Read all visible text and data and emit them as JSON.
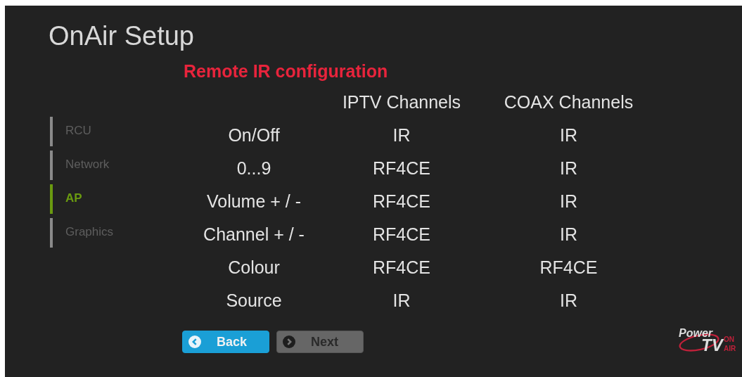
{
  "window": {
    "title": "OnAir Setup"
  },
  "sidebar": {
    "items": [
      {
        "label": "RCU",
        "selected": false
      },
      {
        "label": "Network",
        "selected": false
      },
      {
        "label": "AP",
        "selected": true
      },
      {
        "label": "Graphics",
        "selected": false
      }
    ]
  },
  "section_title": "Remote IR configuration",
  "table": {
    "columns": [
      "IPTV Channels",
      "COAX Channels"
    ],
    "rows": [
      {
        "label": "On/Off",
        "cells": [
          "IR",
          "IR"
        ]
      },
      {
        "label": "0...9",
        "cells": [
          "RF4CE",
          "IR"
        ]
      },
      {
        "label": "Volume + / -",
        "cells": [
          "RF4CE",
          "IR"
        ]
      },
      {
        "label": "Channel + / -",
        "cells": [
          "RF4CE",
          "IR"
        ]
      },
      {
        "label": "Colour",
        "cells": [
          "RF4CE",
          "RF4CE"
        ]
      },
      {
        "label": "Source",
        "cells": [
          "IR",
          "IR"
        ]
      }
    ]
  },
  "buttons": [
    {
      "label": "Back",
      "kind": "back",
      "selected": true
    },
    {
      "label": "Next",
      "kind": "next",
      "selected": false
    }
  ],
  "logo": {
    "word": "Power",
    "big": "TV",
    "top": "ON",
    "bottom": "AIR"
  }
}
